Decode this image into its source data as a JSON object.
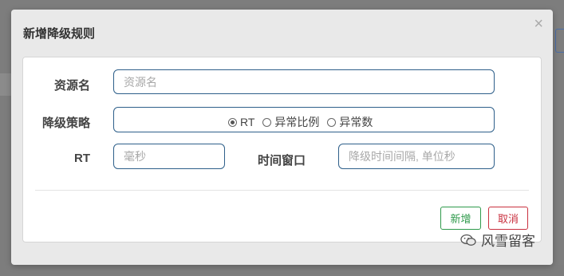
{
  "dialog": {
    "title": "新增降级规则",
    "close_symbol": "×"
  },
  "form": {
    "resource": {
      "label": "资源名",
      "placeholder": "资源名",
      "value": ""
    },
    "strategy": {
      "label": "降级策略",
      "options": [
        "RT",
        "异常比例",
        "异常数"
      ],
      "selected": "RT"
    },
    "rt": {
      "label": "RT",
      "placeholder": "毫秒",
      "value": ""
    },
    "time_window": {
      "label": "时间窗口",
      "placeholder": "降级时间间隔, 单位秒",
      "value": ""
    }
  },
  "buttons": {
    "add": "新增",
    "cancel": "取消"
  },
  "watermark": {
    "text": "风雪留客",
    "icon": "wechat-icon"
  },
  "colors": {
    "add_button": "#2f9a4b",
    "cancel_button": "#c9303f",
    "input_border": "#2e5f8a"
  }
}
